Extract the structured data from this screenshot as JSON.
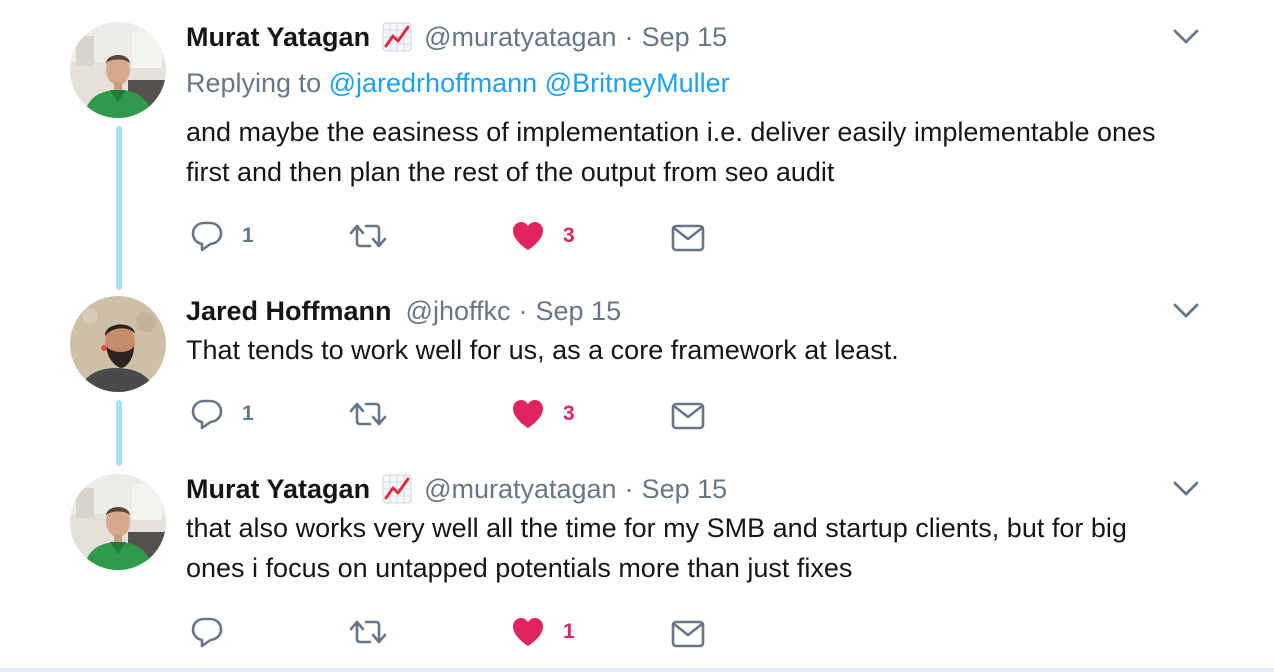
{
  "colors": {
    "thread_line": "#a9dff4",
    "link": "#1da1f2",
    "meta_gray": "#657786",
    "like_red": "#e0245e",
    "text": "#14171a"
  },
  "tweets": [
    {
      "name": "Murat Yatagan",
      "has_emoji": true,
      "emoji_icon": "chart-increasing-icon",
      "handle": "@muratyatagan",
      "dot": "·",
      "date": "Sep 15",
      "replying_prefix": "Replying to",
      "mentions": [
        "@jaredrhoffmann",
        "@BritneyMuller"
      ],
      "text_lines": [
        "and maybe the easiness of implementation i.e. deliver easily implementable ones",
        "first and then plan the rest of the output from seo audit"
      ],
      "reply_count": "1",
      "retweet_count": "",
      "like_count": "3",
      "liked": true
    },
    {
      "name": "Jared Hoffmann",
      "has_emoji": false,
      "handle": "@jhoffkc",
      "dot": "·",
      "date": "Sep 15",
      "text_lines": [
        "That tends to work well for us, as a core framework at least."
      ],
      "reply_count": "1",
      "retweet_count": "",
      "like_count": "3",
      "liked": true
    },
    {
      "name": "Murat Yatagan",
      "has_emoji": true,
      "emoji_icon": "chart-increasing-icon",
      "handle": "@muratyatagan",
      "dot": "·",
      "date": "Sep 15",
      "text_lines": [
        "that also works very well all the time for my SMB and startup clients, but for big",
        "ones i focus on untapped potentials more than just fixes"
      ],
      "reply_count": "",
      "retweet_count": "",
      "like_count": "1",
      "liked": true
    }
  ]
}
